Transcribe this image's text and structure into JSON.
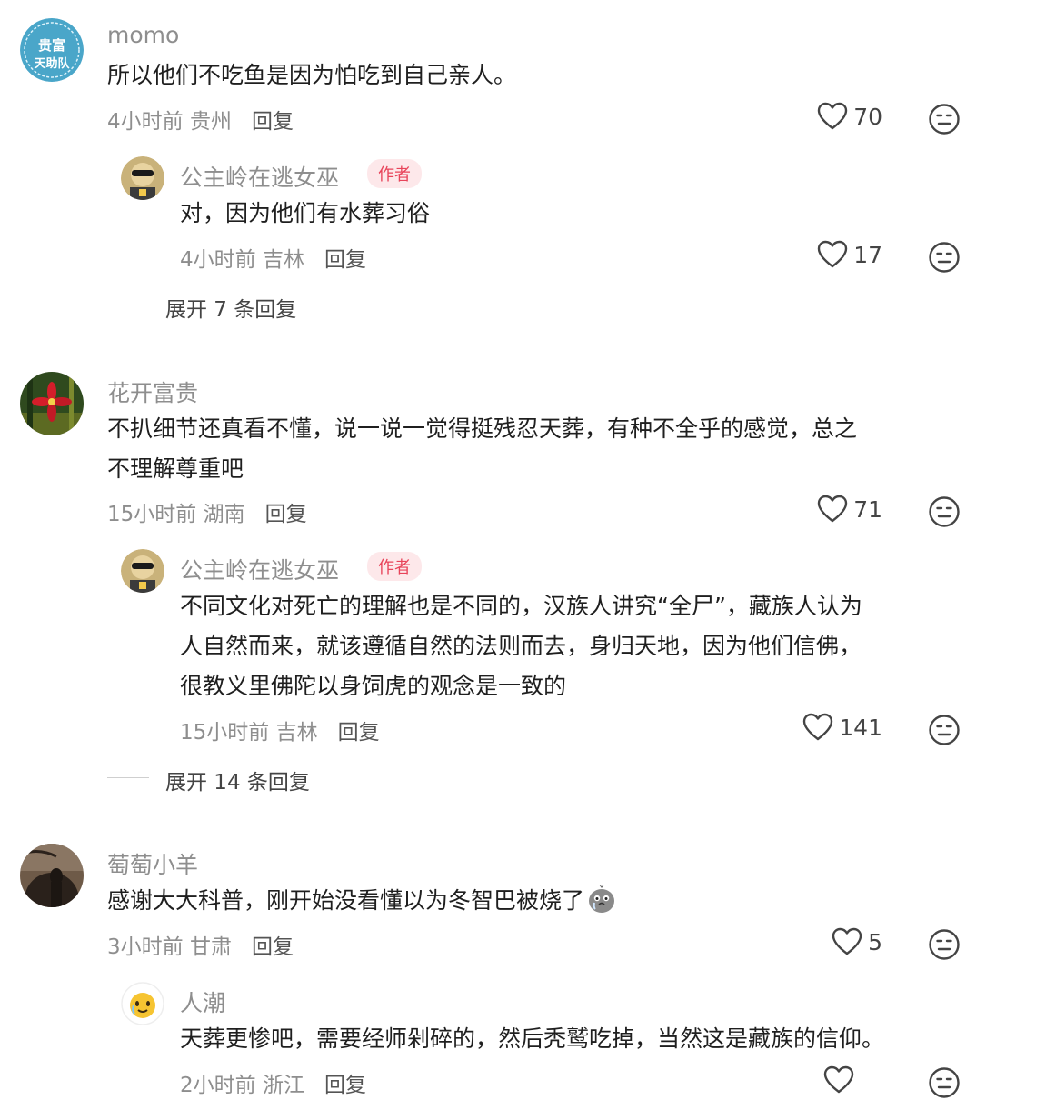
{
  "comments": [
    {
      "username": "momo",
      "avatar_text_top": "贵富",
      "avatar_text_bottom": "天助队",
      "text_lines": [
        "所以他们不吃鱼是因为怕吃到自己亲人。"
      ],
      "meta": "4小时前 贵州",
      "reply_label": "回复",
      "likes": "70",
      "replies": [
        {
          "username": "公主岭在逃女巫",
          "badge": "作者",
          "text_lines": [
            "对，因为他们有水葬习俗"
          ],
          "meta": "4小时前 吉林",
          "reply_label": "回复",
          "likes": "17"
        }
      ],
      "expand_label": "展开 7 条回复"
    },
    {
      "username": "花开富贵",
      "text_lines": [
        "不扒细节还真看不懂，说一说一觉得挺残忍天葬，有种不全乎的感觉，总之",
        "不理解尊重吧"
      ],
      "meta": "15小时前 湖南",
      "reply_label": "回复",
      "likes": "71",
      "replies": [
        {
          "username": "公主岭在逃女巫",
          "badge": "作者",
          "text_lines": [
            "不同文化对死亡的理解也是不同的，汉族人讲究“全尸”，藏族人认为",
            "人自然而来，就该遵循自然的法则而去，身归天地，因为他们信佛，",
            "很教义里佛陀以身饲虎的观念是一致的"
          ],
          "meta": "15小时前 吉林",
          "reply_label": "回复",
          "likes": "141"
        }
      ],
      "expand_label": "展开 14 条回复"
    },
    {
      "username": "萄萄小羊",
      "text_lines": [
        "感谢大大科普，刚开始没看懂以为冬智巴被烧了"
      ],
      "meta": "3小时前 甘肃",
      "reply_label": "回复",
      "likes": "5",
      "replies": [
        {
          "username": "人潮",
          "text_lines": [
            "天葬更惨吧，需要经师剁碎的，然后秃鹫吃掉，当然这是藏族的信仰。"
          ],
          "meta": "2小时前 浙江",
          "reply_label": "回复",
          "likes": ""
        }
      ]
    }
  ],
  "colors": {
    "username": "#8e8e8e",
    "badge_text": "#e8445a",
    "badge_bg": "#fde8ea",
    "text": "#1f1f1f"
  },
  "icons": {
    "like": "heart-outline-icon",
    "dislike": "neutral-face-icon",
    "emoji": "crying-chick-emoji"
  }
}
